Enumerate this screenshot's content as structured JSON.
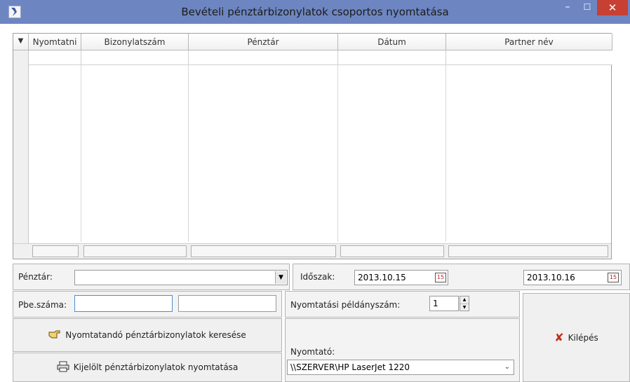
{
  "window": {
    "title": "Bevételi pénztárbizonylatok csoportos nyomtatása",
    "controls": {
      "minimize": "–",
      "maximize": "☐",
      "close": "✕"
    }
  },
  "grid": {
    "columns": [
      "Nyomtatni",
      "Bizonylatszám",
      "Pénztár",
      "Dátum",
      "Partner név"
    ],
    "rows": []
  },
  "filters": {
    "penztar_label": "Pénztár:",
    "penztar_value": "",
    "idoszak_label": "Időszak:",
    "date_from": "2013.10.15",
    "date_to": "2013.10.16",
    "pbe_label": "Pbe.száma:",
    "pbe_value1": "",
    "pbe_value2": "",
    "copies_label": "Nyomtatási példányszám:",
    "copies_value": "1",
    "printer_label": "Nyomtató:",
    "printer_value": "\\\\SZERVER\\HP LaserJet 1220"
  },
  "actions": {
    "search_label": "Nyomtatandó pénztárbizonylatok keresése",
    "print_label": "Kijelölt pénztárbizonylatok nyomtatása",
    "exit_label": "Kilépés"
  },
  "icons": {
    "calendar_text": "15",
    "dropdown": "▼",
    "spin_up": "▲",
    "spin_down": "▼"
  }
}
